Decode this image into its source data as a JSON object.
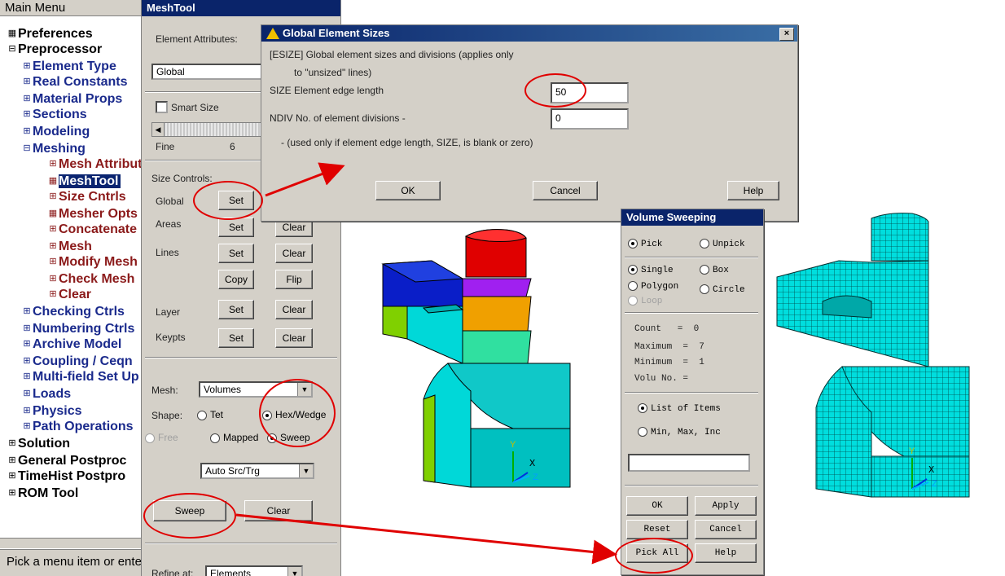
{
  "main_menu": {
    "title": "Main Menu",
    "items": [
      {
        "label": "Preferences",
        "box": "▦",
        "level": 0
      },
      {
        "label": "Preprocessor",
        "box": "⊟",
        "level": 0
      },
      {
        "label": "Element Type",
        "box": "⊞",
        "level": 1
      },
      {
        "label": "Real Constants",
        "box": "⊞",
        "level": 1
      },
      {
        "label": "Material Props",
        "box": "⊞",
        "level": 1
      },
      {
        "label": "Sections",
        "box": "⊞",
        "level": 1
      },
      {
        "label": "Modeling",
        "box": "⊞",
        "level": 1
      },
      {
        "label": "Meshing",
        "box": "⊟",
        "level": 1
      },
      {
        "label": "Mesh Attributes",
        "box": "⊞",
        "level": 2
      },
      {
        "label": "MeshTool",
        "box": "▦",
        "level": 2,
        "selected": true
      },
      {
        "label": "Size Cntrls",
        "box": "⊞",
        "level": 2
      },
      {
        "label": "Mesher Opts",
        "box": "▦",
        "level": 2
      },
      {
        "label": "Concatenate",
        "box": "⊞",
        "level": 2
      },
      {
        "label": "Mesh",
        "box": "⊞",
        "level": 2
      },
      {
        "label": "Modify Mesh",
        "box": "⊞",
        "level": 2
      },
      {
        "label": "Check Mesh",
        "box": "⊞",
        "level": 2
      },
      {
        "label": "Clear",
        "box": "⊞",
        "level": 2
      },
      {
        "label": "Checking Ctrls",
        "box": "⊞",
        "level": 1
      },
      {
        "label": "Numbering Ctrls",
        "box": "⊞",
        "level": 1
      },
      {
        "label": "Archive Model",
        "box": "⊞",
        "level": 1
      },
      {
        "label": "Coupling / Ceqn",
        "box": "⊞",
        "level": 1
      },
      {
        "label": "Multi-field Set Up",
        "box": "⊞",
        "level": 1
      },
      {
        "label": "Loads",
        "box": "⊞",
        "level": 1
      },
      {
        "label": "Physics",
        "box": "⊞",
        "level": 1
      },
      {
        "label": "Path Operations",
        "box": "⊞",
        "level": 1
      },
      {
        "label": "Solution",
        "box": "⊞",
        "level": 0
      },
      {
        "label": "General Postproc",
        "box": "⊞",
        "level": 0
      },
      {
        "label": "TimeHist Postpro",
        "box": "⊞",
        "level": 0
      },
      {
        "label": "ROM Tool",
        "box": "⊞",
        "level": 0
      }
    ],
    "status": "Pick a menu item or enter a command"
  },
  "meshtool": {
    "title": "MeshTool",
    "element_attributes_label": "Element Attributes:",
    "element_attributes_value": "Global",
    "smart_size_label": "Smart Size",
    "fine_label": "Fine",
    "fine_value": "6",
    "size_controls_label": "Size Controls:",
    "global_label": "Global",
    "areas_label": "Areas",
    "lines_label": "Lines",
    "layer_label": "Layer",
    "keypts_label": "Keypts",
    "set_label": "Set",
    "clear_label": "Clear",
    "copy_label": "Copy",
    "flip_label": "Flip",
    "mesh_label": "Mesh:",
    "mesh_value": "Volumes",
    "shape_label": "Shape:",
    "tet_label": "Tet",
    "hex_label": "Hex/Wedge",
    "free_label": "Free",
    "mapped_label": "Mapped",
    "sweep_radio_label": "Sweep",
    "src_trg_value": "Auto Src/Trg",
    "sweep_button": "Sweep",
    "clear_button": "Clear",
    "refine_label": "Refine at:",
    "refine_value": "Elements"
  },
  "global_sizes": {
    "title": "Global Element Sizes",
    "close": "×",
    "desc_line1": "[ESIZE]  Global element sizes and divisions (applies only",
    "desc_line2": "to \"unsized\" lines)",
    "size_label": "SIZE  Element edge length",
    "size_value": "50",
    "ndiv_label": "NDIV  No. of element divisions -",
    "ndiv_value": "0",
    "note": "- (used only if element edge length, SIZE, is blank or zero)",
    "ok": "OK",
    "cancel": "Cancel",
    "help": "Help"
  },
  "volume_sweeping": {
    "title": "Volume Sweeping",
    "pick": "Pick",
    "unpick": "Unpick",
    "single": "Single",
    "box": "Box",
    "polygon": "Polygon",
    "circle": "Circle",
    "loop": "Loop",
    "count_line": "Count   =  0",
    "maximum_line": "Maximum  =  7",
    "minimum_line": "Minimum  =  1",
    "volu_line": "Volu No. =",
    "list_items": "List of Items",
    "min_max_inc": "Min, Max, Inc",
    "ok": "OK",
    "apply": "Apply",
    "reset": "Reset",
    "cancel": "Cancel",
    "pick_all": "Pick All",
    "help": "Help"
  },
  "triad": {
    "y": "Y",
    "x": "X",
    "z": "Z"
  },
  "colors": {
    "mesh": "#00d8d8",
    "annotation": "#e00000",
    "title_bar": "#0a246a"
  }
}
